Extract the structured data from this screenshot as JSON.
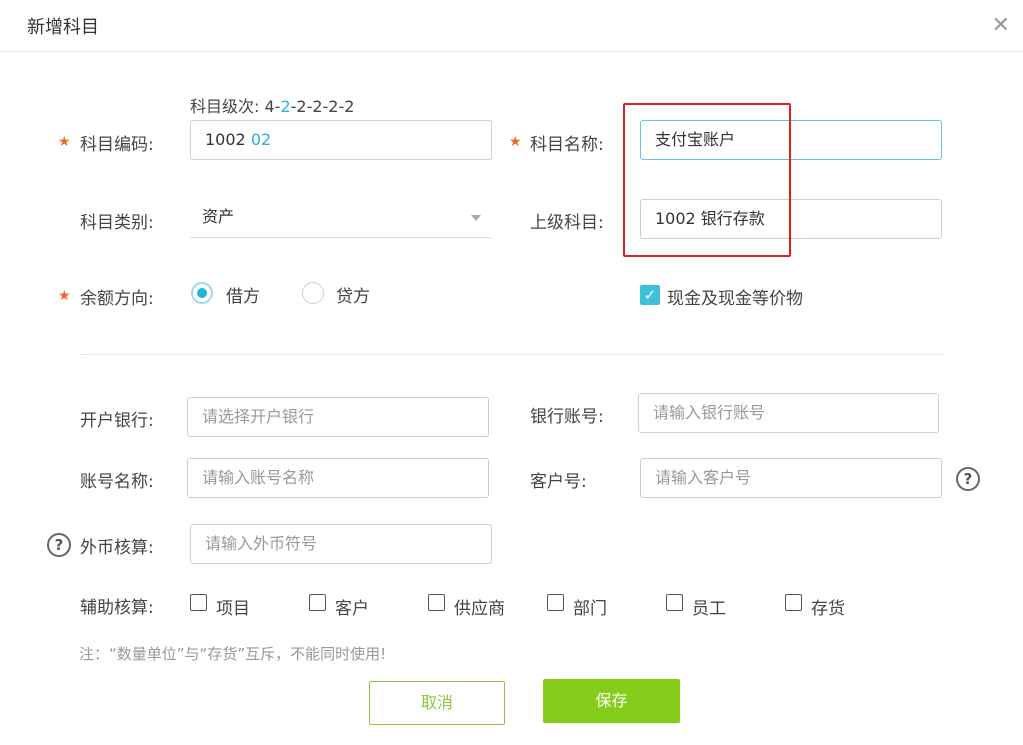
{
  "dialog": {
    "title": "新增科目",
    "close": "✕"
  },
  "form": {
    "level_hint": {
      "prefix": "科目级次:  4-",
      "highlight": "2",
      "suffix": "-2-2-2-2"
    },
    "code": {
      "label": "科目编码:",
      "value_main": "1002 ",
      "value_highlight": "02"
    },
    "name": {
      "label": "科目名称:",
      "value": "支付宝账户"
    },
    "category": {
      "label": "科目类别:",
      "value": "资产"
    },
    "parent": {
      "label": "上级科目:",
      "value": "1002 银行存款"
    },
    "balance_direction": {
      "label": "余额方向:",
      "options": [
        "借方",
        "贷方"
      ],
      "selected": "借方"
    },
    "cash_equivalent": {
      "label": "现金及现金等价物",
      "checked": true,
      "check_glyph": "✓"
    },
    "bank": {
      "label": "开户银行:",
      "placeholder": "请选择开户银行"
    },
    "bank_account": {
      "label": "银行账号:",
      "placeholder": "请输入银行账号"
    },
    "account_name": {
      "label": "账号名称:",
      "placeholder": "请输入账号名称"
    },
    "customer_no": {
      "label": "客户号:",
      "placeholder": "请输入客户号"
    },
    "foreign_currency": {
      "label": "外币核算:",
      "placeholder": "请输入外币符号"
    },
    "aux": {
      "label": "辅助核算:",
      "items": [
        "项目",
        "客户",
        "供应商",
        "部门",
        "员工",
        "存货"
      ]
    },
    "note": "注：“数量单位”与“存货”互斥，不能同时使用!",
    "help_glyph": "?"
  },
  "buttons": {
    "cancel": "取消",
    "save": "保存"
  },
  "colors": {
    "accent": "#26b4d1",
    "primary_green": "#86cc1a",
    "required_star": "#f26522",
    "highlight_box": "#e02020"
  },
  "icons": {
    "close": "close-icon",
    "help": "question-circle-icon",
    "required": "required-star-icon"
  }
}
